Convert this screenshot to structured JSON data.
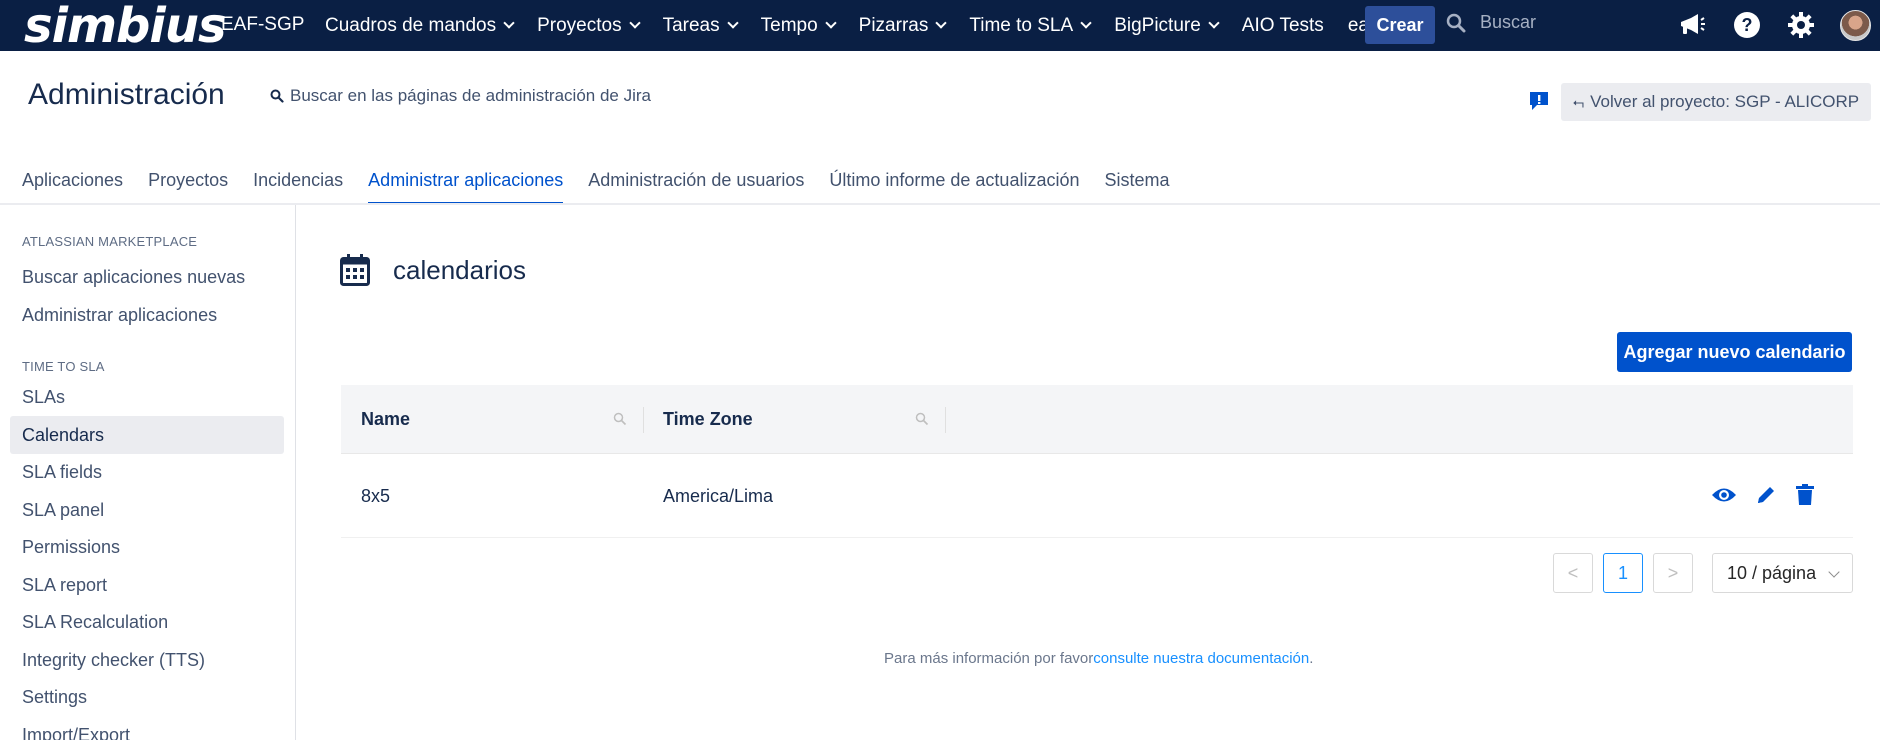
{
  "topnav": {
    "logo": "simbius",
    "site": "EAF-SGP",
    "items": [
      {
        "label": "Cuadros de mandos",
        "dropdown": true
      },
      {
        "label": "Proyectos",
        "dropdown": true
      },
      {
        "label": "Tareas",
        "dropdown": true
      },
      {
        "label": "Tempo",
        "dropdown": true
      },
      {
        "label": "Pizarras",
        "dropdown": true
      },
      {
        "label": "Time to SLA",
        "dropdown": true
      },
      {
        "label": "BigPicture",
        "dropdown": true
      },
      {
        "label": "AIO Tests",
        "dropdown": false
      },
      {
        "label": "eazyBI",
        "dropdown": false
      }
    ],
    "create_label": "Crear",
    "search_placeholder": "Buscar",
    "icons": [
      "megaphone-icon",
      "help-icon",
      "settings-icon",
      "avatar"
    ]
  },
  "header": {
    "title": "Administración",
    "search_label": "Buscar en las páginas de administración de Jira",
    "back_button": "Volver al proyecto: SGP - ALICORP"
  },
  "tabs": [
    {
      "label": "Aplicaciones",
      "active": false
    },
    {
      "label": "Proyectos",
      "active": false
    },
    {
      "label": "Incidencias",
      "active": false
    },
    {
      "label": "Administrar aplicaciones",
      "active": true
    },
    {
      "label": "Administración de usuarios",
      "active": false
    },
    {
      "label": "Último informe de actualización",
      "active": false
    },
    {
      "label": "Sistema",
      "active": false
    }
  ],
  "sidebar": {
    "sections": [
      {
        "title": "ATLASSIAN MARKETPLACE",
        "items": [
          "Buscar aplicaciones nuevas",
          "Administrar aplicaciones"
        ]
      },
      {
        "title": "TIME TO SLA",
        "items": [
          "SLAs",
          "Calendars",
          "SLA fields",
          "SLA panel",
          "Permissions",
          "SLA report",
          "SLA Recalculation",
          "Integrity checker (TTS)",
          "Settings",
          "Import/Export"
        ]
      }
    ],
    "active_item": "Calendars"
  },
  "main": {
    "heading": "calendarios",
    "add_button": "Agregar nuevo calendario",
    "table": {
      "columns": [
        "Name",
        "Time Zone"
      ],
      "rows": [
        {
          "name": "8x5",
          "time_zone": "America/Lima",
          "actions": [
            "view-icon",
            "edit-icon",
            "delete-icon"
          ]
        }
      ]
    },
    "pagination": {
      "current_page": "1",
      "prev": "<",
      "next": ">",
      "page_size": "10 / página"
    },
    "footer_text": "Para más información por favor",
    "footer_link": "consulte nuestra documentación",
    "footer_end": "."
  },
  "colors": {
    "nav_bg": "#0a1f44",
    "primary": "#0052cc",
    "link": "#1890ff"
  }
}
